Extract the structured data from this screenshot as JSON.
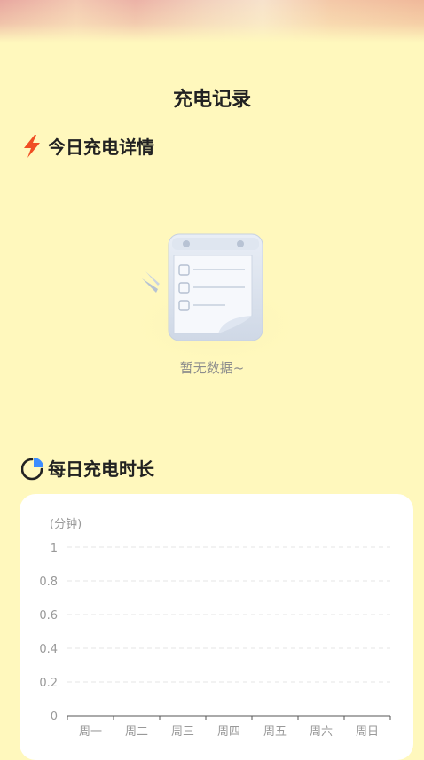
{
  "header": {
    "title": "充电记录"
  },
  "today_section": {
    "title": "今日充电详情",
    "icon": "lightning-icon",
    "empty_text": "暂无数据~"
  },
  "daily_section": {
    "title": "每日充电时长",
    "icon": "pie-chart-icon"
  },
  "colors": {
    "background": "#fff8bd",
    "lightning": "#f04e23",
    "card": "#ffffff"
  },
  "chart_data": {
    "type": "bar",
    "unit_label": "(分钟)",
    "categories": [
      "周一",
      "周二",
      "周三",
      "周四",
      "周五",
      "周六",
      "周日"
    ],
    "values": [
      0,
      0,
      0,
      0,
      0,
      0,
      0
    ],
    "yticks": [
      "0",
      "0.2",
      "0.4",
      "0.6",
      "0.8",
      "1"
    ],
    "ylim": [
      0,
      1
    ],
    "grid": true
  }
}
